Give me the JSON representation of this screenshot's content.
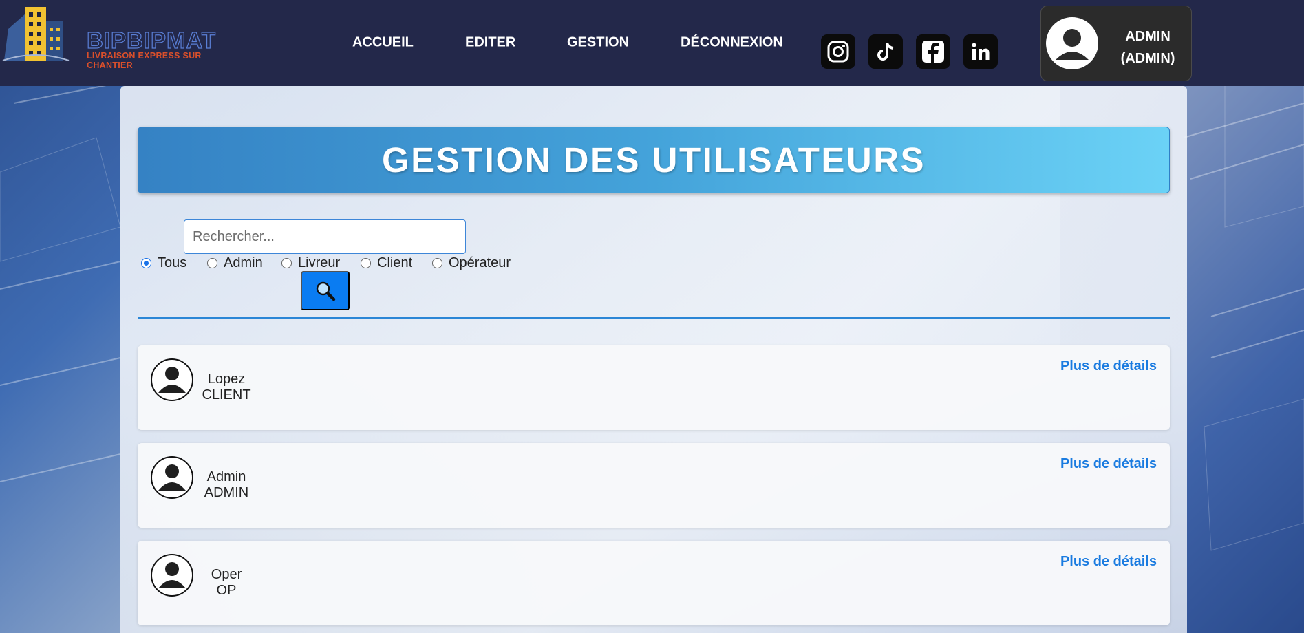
{
  "brand": {
    "name": "BIPBIPMAT",
    "tagline": "LIVRAISON EXPRESS SUR CHANTIER",
    "logo_icon": "building-logo-icon"
  },
  "nav": {
    "items": [
      {
        "label": "ACCUEIL"
      },
      {
        "label": "EDITER"
      },
      {
        "label": "GESTION"
      },
      {
        "label": "DÉCONNEXION"
      }
    ]
  },
  "social": [
    {
      "icon": "instagram-icon"
    },
    {
      "icon": "tiktok-icon"
    },
    {
      "icon": "facebook-icon"
    },
    {
      "icon": "linkedin-icon"
    }
  ],
  "profile": {
    "name": "ADMIN",
    "role": "(ADMIN)",
    "icon": "user-avatar-icon"
  },
  "page": {
    "title": "GESTION DES UTILISATEURS"
  },
  "search": {
    "placeholder": "Rechercher...",
    "value": "",
    "button_icon": "search-icon"
  },
  "filters": {
    "selected": "Tous",
    "options": [
      {
        "label": "Tous",
        "checked": true
      },
      {
        "label": "Admin",
        "checked": false
      },
      {
        "label": "Livreur",
        "checked": false
      },
      {
        "label": "Client",
        "checked": false
      },
      {
        "label": "Opérateur",
        "checked": false
      }
    ]
  },
  "users": [
    {
      "name": "Lopez",
      "role": "CLIENT",
      "link": "Plus de détails"
    },
    {
      "name": "Admin",
      "role": "ADMIN",
      "link": "Plus de détails"
    },
    {
      "name": "Oper",
      "role": "OP",
      "link": "Plus de détails"
    }
  ],
  "colors": {
    "header_bg": "#23284a",
    "accent": "#1a7be0",
    "title_gradient_start": "#3582c4",
    "title_gradient_end": "#6bd2f6",
    "search_button": "#0a7cf2"
  }
}
